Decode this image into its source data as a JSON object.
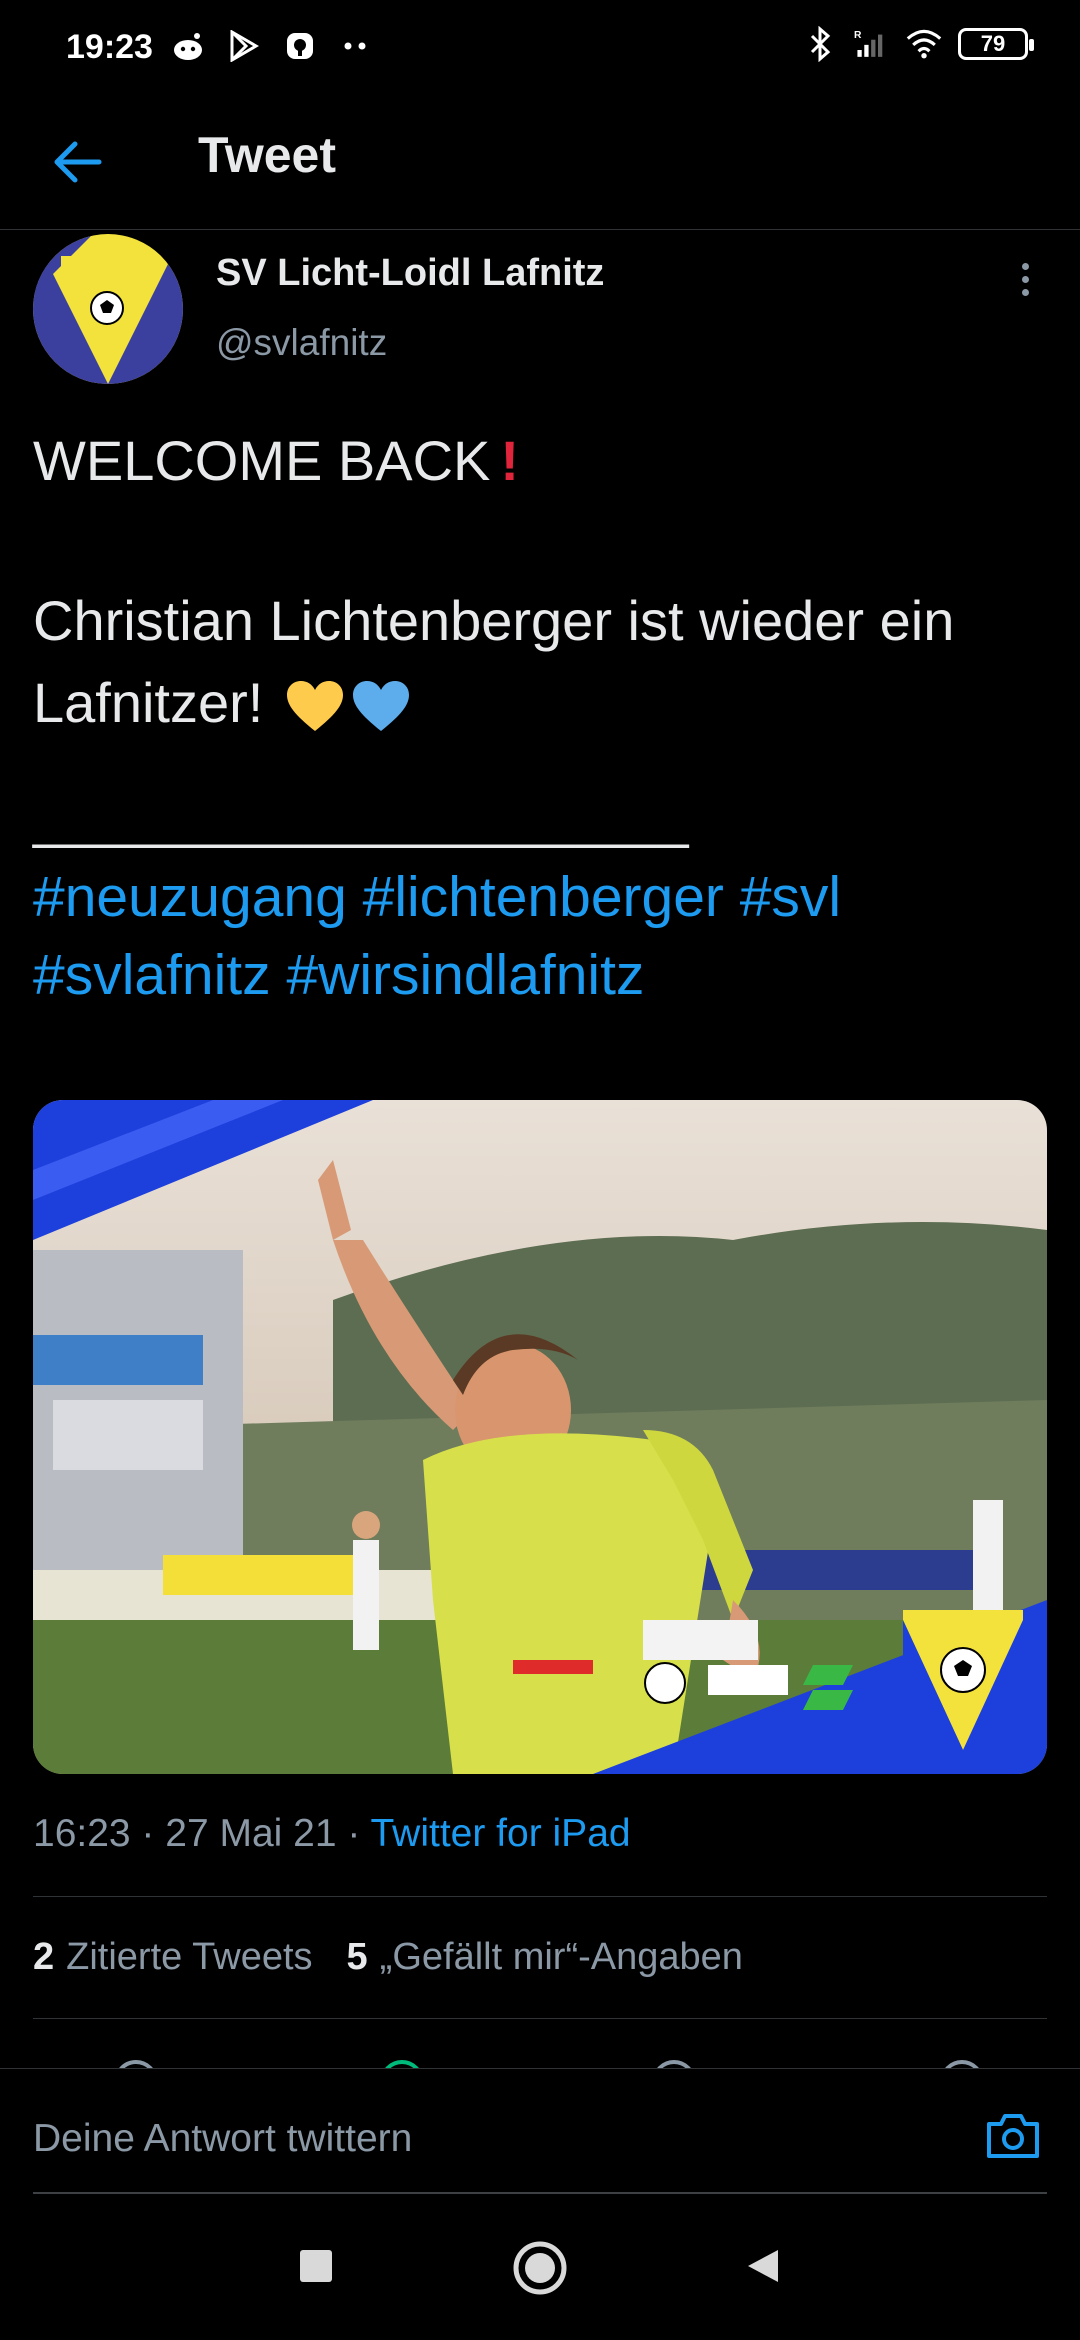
{
  "status_bar": {
    "time": "19:23",
    "left_icons": [
      "reddit-icon",
      "play-store-icon",
      "notification-icon",
      "more-dots-icon"
    ],
    "right_icons": [
      "bluetooth-icon",
      "signal-icon",
      "wifi-icon"
    ],
    "battery": "79"
  },
  "header": {
    "title": "Tweet",
    "accent_color": "#1d9bf0"
  },
  "tweet": {
    "author_name": "SV Licht-Loidl Lafnitz",
    "author_handle": "@svlafnitz",
    "line1": "WELCOME BACK",
    "line2": "Christian Lichtenberger ist wieder ein",
    "line3": "Lafnitzer!",
    "divider": "________________________",
    "hashtags_line1": [
      "#neuzugang",
      "#lichtenberger",
      "#svl"
    ],
    "hashtags_line2": [
      "#svlafnitz",
      "#wirsindlafnitz"
    ],
    "media_alt": "",
    "timestamp": "16:23 · 27 Mai 21 · ",
    "source": "Twitter for iPad"
  },
  "stats": {
    "quotes_count": "2",
    "quotes_label": "Zitierte Tweets",
    "likes_count": "5",
    "likes_label": "„Gefällt mir“-Angaben"
  },
  "reply": {
    "placeholder": "Deine Antwort twittern"
  },
  "navigation": {
    "buttons": [
      "recents-button",
      "home-button",
      "back-button"
    ]
  }
}
